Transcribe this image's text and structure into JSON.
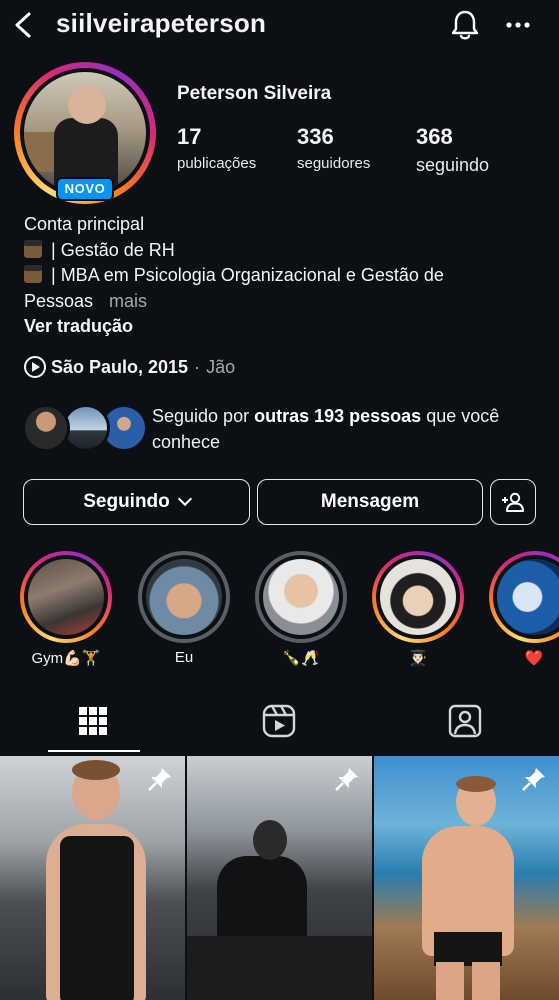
{
  "header": {
    "username": "siilveirapeterson",
    "back_icon": "back-arrow-icon",
    "notifications_icon": "bell-icon",
    "more_icon": "more-horizontal-icon"
  },
  "profile": {
    "new_badge": "NOVO",
    "full_name": "Peterson Silveira",
    "stats": [
      {
        "value": "17",
        "label": "publicações"
      },
      {
        "value": "336",
        "label": "seguidores"
      },
      {
        "value": "368",
        "label": "seguindo"
      }
    ],
    "bio": {
      "line1": "Conta principal",
      "line2": "| Gestão de RH",
      "line3": "| MBA em Psicologia Organizacional e Gestão de",
      "line4": "Pessoas",
      "more": "mais"
    },
    "see_translation": "Ver tradução",
    "location": {
      "name": "São Paulo, 2015",
      "separator": "·",
      "extra": "Jão"
    },
    "followed_by": {
      "prefix": "Seguido por",
      "bold": "outras 193 pessoas",
      "suffix": "que você conhece"
    }
  },
  "actions": {
    "following_label": "Seguindo",
    "message_label": "Mensagem",
    "add_user_icon": "add-user-icon"
  },
  "highlights": [
    {
      "label": "Gym💪🏻🏋️",
      "ring": "gradient"
    },
    {
      "label": "Eu",
      "ring": "gray"
    },
    {
      "label": "🍾🥂",
      "ring": "gray"
    },
    {
      "label": "👨🏻‍🎓",
      "ring": "gradient"
    },
    {
      "label": "❤️",
      "ring": "gradient"
    }
  ],
  "tabs": [
    {
      "name": "grid",
      "icon": "grid-icon",
      "active": true
    },
    {
      "name": "reels",
      "icon": "reels-icon",
      "active": false
    },
    {
      "name": "tagged",
      "icon": "tagged-user-icon",
      "active": false
    }
  ],
  "colors": {
    "background": "#0c1014",
    "accent_blue": "#0095f6",
    "secondary_text": "#a8a8a8"
  }
}
